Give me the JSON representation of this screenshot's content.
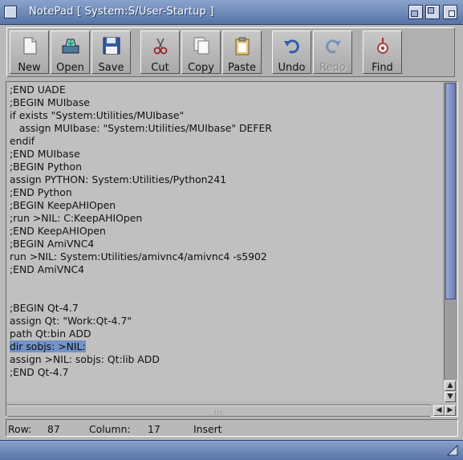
{
  "window": {
    "title": "NotePad [ System:S/User-Startup ]"
  },
  "toolbar": {
    "new_label": "New",
    "open_label": "Open",
    "save_label": "Save",
    "cut_label": "Cut",
    "copy_label": "Copy",
    "paste_label": "Paste",
    "undo_label": "Undo",
    "redo_label": "Redo",
    "find_label": "Find",
    "redo_disabled": true
  },
  "editor": {
    "lines": [
      ";END UADE",
      ";BEGIN MUIbase",
      "if exists \"System:Utilities/MUIbase\"",
      "   assign MUIbase: \"System:Utilities/MUIbase\" DEFER",
      "endif",
      ";END MUIbase",
      ";BEGIN Python",
      "assign PYTHON: System:Utilities/Python241",
      ";END Python",
      ";BEGIN KeepAHIOpen",
      ";run >NIL: C:KeepAHIOpen",
      ";END KeepAHIOpen",
      ";BEGIN AmiVNC4",
      "run >NIL: System:Utilities/amivnc4/amivnc4 -s5902",
      ";END AmiVNC4",
      "",
      "",
      ";BEGIN Qt-4.7",
      "assign Qt: \"Work:Qt-4.7\"",
      "path Qt:bin ADD",
      "dir sobjs: >NIL:",
      "assign >NIL: sobjs: Qt:lib ADD",
      ";END Qt-4.7"
    ],
    "selected_line": 20
  },
  "status": {
    "row_label": "Row:",
    "row_value": "87",
    "column_label": "Column:",
    "column_value": "17",
    "mode": "Insert"
  },
  "colors": {
    "titlebar": "#6b84b8",
    "selection": "#7393c8",
    "editor_bg": "#c0c0c0"
  }
}
